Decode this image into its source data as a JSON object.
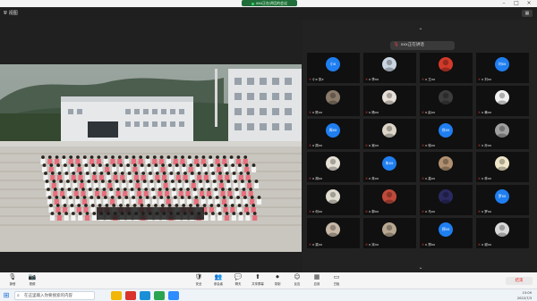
{
  "window": {
    "title": "xxx正在讲话的会议",
    "minimize_icon": "minimize-icon",
    "maximize_icon": "maximize-icon",
    "close_icon": "close-icon"
  },
  "topbar": {
    "share_label": "视图"
  },
  "gallery": {
    "speaker_label": "xxx正在讲话",
    "tiles": [
      {
        "name": "小x 张x",
        "avatar_type": "circle",
        "avatar_color": "#1f7ef0",
        "avatar_text": "小x"
      },
      {
        "name": "x 李xx",
        "avatar_type": "photo",
        "avatar_color": "#c9d6e2"
      },
      {
        "name": "x 王xx",
        "avatar_type": "photo",
        "avatar_color": "#d23a2a"
      },
      {
        "name": "x 刘xx",
        "avatar_type": "circle",
        "avatar_color": "#1f7ef0",
        "avatar_text": "刘xx"
      },
      {
        "name": "x 陈xx",
        "avatar_type": "photo",
        "avatar_color": "#8a7a6a"
      },
      {
        "name": "x 杨xx",
        "avatar_type": "photo",
        "avatar_color": "#e8e0d8"
      },
      {
        "name": "x 赵xx",
        "avatar_type": "photo",
        "avatar_color": "#3c3c3c"
      },
      {
        "name": "x 黄xx",
        "avatar_type": "photo",
        "avatar_color": "#f0f0f0"
      },
      {
        "name": "x 周xx",
        "avatar_type": "circle",
        "avatar_color": "#1f7ef0",
        "avatar_text": "周xx"
      },
      {
        "name": "x 吴xx",
        "avatar_type": "photo",
        "avatar_color": "#ddd6c8"
      },
      {
        "name": "x 徐xx",
        "avatar_type": "circle",
        "avatar_color": "#1f7ef0",
        "avatar_text": "徐xx"
      },
      {
        "name": "x 孙xx",
        "avatar_type": "photo",
        "avatar_color": "#a0a0a0"
      },
      {
        "name": "x 胡xx",
        "avatar_type": "photo",
        "avatar_color": "#e6e0d6"
      },
      {
        "name": "x 朱xx",
        "avatar_type": "circle",
        "avatar_color": "#1f7ef0",
        "avatar_text": "朱xx"
      },
      {
        "name": "x 高xx",
        "avatar_type": "photo",
        "avatar_color": "#b09070"
      },
      {
        "name": "x 林xx",
        "avatar_type": "photo",
        "avatar_color": "#efe6c8"
      },
      {
        "name": "x 何xx",
        "avatar_type": "photo",
        "avatar_color": "#e0dccf"
      },
      {
        "name": "x 郭xx",
        "avatar_type": "photo",
        "avatar_color": "#c04a3a"
      },
      {
        "name": "x 马xx",
        "avatar_type": "photo",
        "avatar_color": "#2a2a60"
      },
      {
        "name": "x 罗xx",
        "avatar_type": "circle",
        "avatar_color": "#1f7ef0",
        "avatar_text": "罗xx"
      },
      {
        "name": "x 梁xx",
        "avatar_type": "photo",
        "avatar_color": "#c8b8a8"
      },
      {
        "name": "x 宋xx",
        "avatar_type": "photo",
        "avatar_color": "#b8a890"
      },
      {
        "name": "x 郑xx",
        "avatar_type": "circle",
        "avatar_color": "#1f7ef0",
        "avatar_text": "郑xx"
      },
      {
        "name": "x 谢xx",
        "avatar_type": "photo",
        "avatar_color": "#d8d8d8"
      }
    ]
  },
  "controls": [
    {
      "label": "静音",
      "icon": "microphone-icon",
      "glyph": "🎙"
    },
    {
      "label": "视频",
      "icon": "camera-icon",
      "glyph": "📷"
    },
    {
      "label": "安全",
      "icon": "shield-icon",
      "glyph": "🛡"
    },
    {
      "label": "参会者",
      "icon": "participants-icon",
      "glyph": "👥"
    },
    {
      "label": "聊天",
      "icon": "chat-icon",
      "glyph": "💬"
    },
    {
      "label": "共享屏幕",
      "icon": "share-screen-icon",
      "glyph": "⬆"
    },
    {
      "label": "录制",
      "icon": "record-icon",
      "glyph": "⏺"
    },
    {
      "label": "反应",
      "icon": "reaction-icon",
      "glyph": "☺"
    },
    {
      "label": "应用",
      "icon": "apps-icon",
      "glyph": "▦"
    },
    {
      "label": "白板",
      "icon": "whiteboard-icon",
      "glyph": "▭"
    }
  ],
  "end_button": "结束",
  "taskbar": {
    "search_placeholder": "在这里输入你要搜索的内容",
    "apps": [
      {
        "icon": "file-explorer-icon",
        "color": "#f2b705"
      },
      {
        "icon": "wps-icon",
        "color": "#d9342b"
      },
      {
        "icon": "edge-icon",
        "color": "#1b8fd6"
      },
      {
        "icon": "chrome-icon",
        "color": "#2aa44f"
      },
      {
        "icon": "meeting-app-icon",
        "color": "#2d8cff"
      }
    ],
    "time": "15:09",
    "date": "2022/7/3"
  },
  "colors": {
    "accent": "#1f7ef0",
    "end_red": "#e33333"
  }
}
